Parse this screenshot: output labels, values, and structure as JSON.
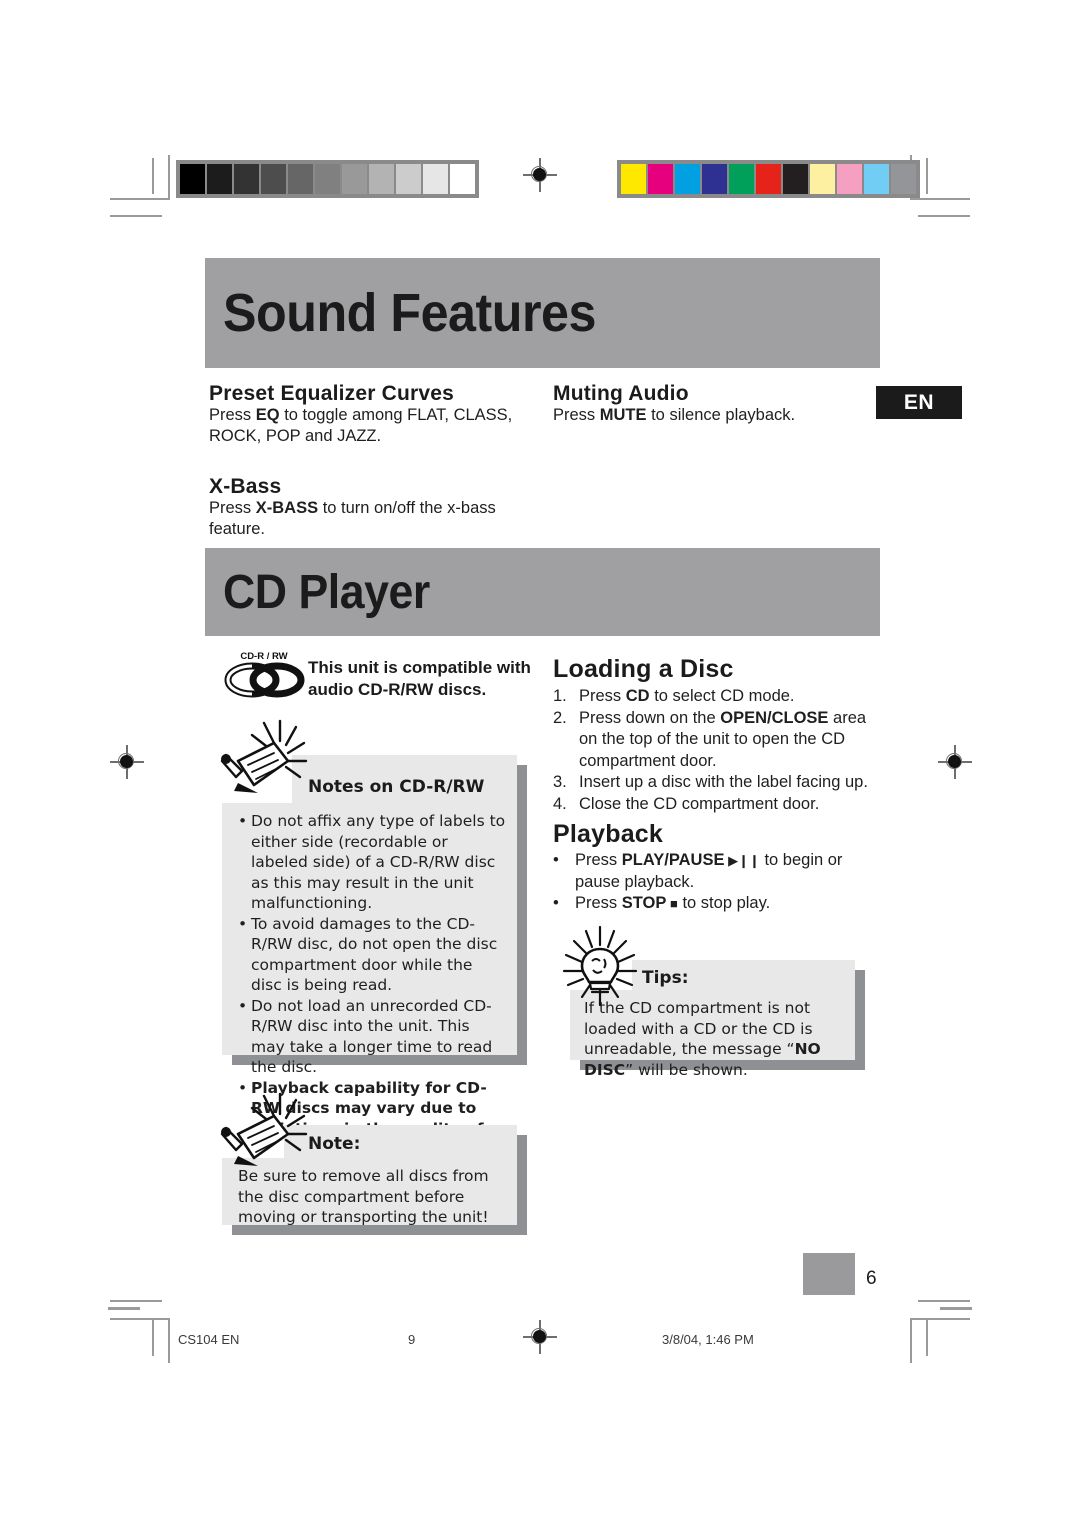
{
  "page": {
    "language_tab": "EN",
    "page_number": "6"
  },
  "banners": {
    "sound_features": "Sound Features",
    "cd_player": "CD Player"
  },
  "sound_features": {
    "preset_eq": {
      "heading": "Preset Equalizer Curves",
      "body_pre": "Press ",
      "body_bold": "EQ",
      "body_post": " to toggle among FLAT, CLASS, ROCK, POP and JAZZ."
    },
    "x_bass": {
      "heading": "X-Bass",
      "body_pre": "Press ",
      "body_bold": "X-BASS",
      "body_post": " to turn on/off the x-bass feature."
    },
    "muting": {
      "heading": "Muting Audio",
      "body_pre": "Press ",
      "body_bold": "MUTE",
      "body_post": " to silence playback."
    }
  },
  "cd_player": {
    "compatibility": {
      "logo_label": "CD-R / RW",
      "line1": "This unit is compatible with",
      "line2": "audio CD-R/RW discs."
    },
    "notes_box": {
      "title": "Notes on CD-R/RW",
      "bullets": [
        {
          "text": "Do not affix any type of labels to either side (recordable or labeled side) of a CD-R/RW disc as this may result in the unit malfunctioning.",
          "bold": false
        },
        {
          "text": "To avoid damages to the CD-R/RW disc, do not open the disc compartment door while the disc is being read.",
          "bold": false
        },
        {
          "text": "Do not load an unrecorded CD-R/RW disc into the unit. This may take a longer time to read the disc.",
          "bold": false
        },
        {
          "text": "Playback capability for CD-RW discs may vary due to variations in the quality of the CD-RW disc and the recorder used to create the disc.",
          "bold": true
        }
      ]
    },
    "note_box": {
      "title": "Note:",
      "text": "Be sure to remove all discs from the  disc compartment before moving or transporting the unit!"
    },
    "loading": {
      "heading": "Loading a Disc",
      "steps": [
        {
          "num": "1.",
          "pre": "Press ",
          "bold": "CD",
          "post": " to select CD mode."
        },
        {
          "num": "2.",
          "pre": "Press down on the ",
          "bold": "OPEN/CLOSE",
          "post": " area on the top of the unit to open the CD compartment door."
        },
        {
          "num": "3.",
          "pre": "Insert up a disc with the label facing up.",
          "bold": "",
          "post": ""
        },
        {
          "num": "4.",
          "pre": "Close the CD compartment door.",
          "bold": "",
          "post": ""
        }
      ]
    },
    "playback": {
      "heading": "Playback",
      "items": [
        {
          "pre": "Press ",
          "bold": "PLAY/PAUSE",
          "glyph": "▶❙❙",
          "post": " to begin or pause playback."
        },
        {
          "pre": "Press ",
          "bold": "STOP",
          "glyph": "■",
          "post": " to stop play."
        }
      ]
    },
    "tips_box": {
      "title": "Tips:",
      "pre": "If the CD compartment is not loaded with a CD or the CD is unreadable, the message “",
      "bold": "NO DISC",
      "post": "” will be shown."
    }
  },
  "footer": {
    "doc_id": "CS104 EN",
    "sheet_number": "9",
    "timestamp": "3/8/04, 1:46 PM"
  },
  "print_marks": {
    "grayscale_steps": [
      "#000000",
      "#1c1c1c",
      "#333333",
      "#4d4d4d",
      "#666666",
      "#808080",
      "#999999",
      "#b3b3b3",
      "#cccccc",
      "#e6e6e6",
      "#ffffff"
    ],
    "color_swatches": [
      "#ffe800",
      "#e6007e",
      "#00a0e3",
      "#2e3192",
      "#00a05a",
      "#e5231b",
      "#231f20",
      "#fdf0a0",
      "#f5a0c0",
      "#72cdf4",
      "#939598"
    ]
  }
}
